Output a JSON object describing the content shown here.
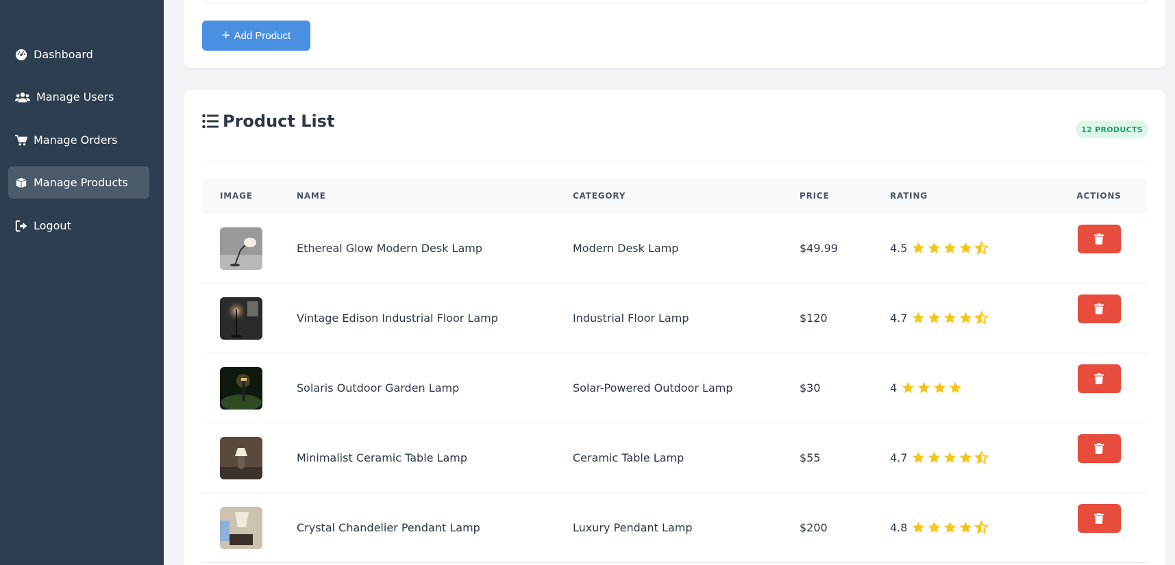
{
  "sidebar": {
    "items": [
      {
        "label": "Dashboard",
        "icon": "dashboard-icon",
        "active": false
      },
      {
        "label": "Manage Users",
        "icon": "users-icon",
        "active": false
      },
      {
        "label": "Manage Orders",
        "icon": "cart-icon",
        "active": false
      },
      {
        "label": "Manage Products",
        "icon": "box-icon",
        "active": true
      },
      {
        "label": "Logout",
        "icon": "logout-icon",
        "active": false
      }
    ]
  },
  "toolbar": {
    "add_label": "Add Product"
  },
  "product_list": {
    "title": "Product List",
    "count_badge": "12 PRODUCTS",
    "columns": [
      "IMAGE",
      "NAME",
      "CATEGORY",
      "PRICE",
      "RATING",
      "ACTIONS"
    ],
    "rows": [
      {
        "name": "Ethereal Glow Modern Desk Lamp",
        "category": "Modern Desk Lamp",
        "price": "$49.99",
        "rating": "4.5",
        "stars": 4.5
      },
      {
        "name": "Vintage Edison Industrial Floor Lamp",
        "category": "Industrial Floor Lamp",
        "price": "$120",
        "rating": "4.7",
        "stars": 4.5
      },
      {
        "name": "Solaris Outdoor Garden Lamp",
        "category": "Solar-Powered Outdoor Lamp",
        "price": "$30",
        "rating": "4",
        "stars": 4
      },
      {
        "name": "Minimalist Ceramic Table Lamp",
        "category": "Ceramic Table Lamp",
        "price": "$55",
        "rating": "4.7",
        "stars": 4.5
      },
      {
        "name": "Crystal Chandelier Pendant Lamp",
        "category": "Luxury Pendant Lamp",
        "price": "$200",
        "rating": "4.8",
        "stars": 4.5
      }
    ]
  },
  "colors": {
    "sidebar_bg": "#2d3e50",
    "accent": "#4a90e2",
    "danger": "#e74c3c",
    "star": "#f5c518",
    "badge_bg": "#dcf7ea",
    "badge_text": "#1e9e63"
  }
}
